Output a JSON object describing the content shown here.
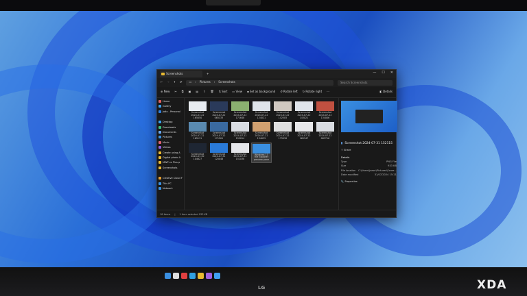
{
  "window": {
    "tab_title": "Screenshots",
    "new_tab": "+",
    "controls": [
      "—",
      "☐",
      "✕"
    ]
  },
  "address": {
    "nav": [
      "←",
      "→",
      "↑",
      "⟳"
    ],
    "breadcrumb": [
      "Pictures",
      "Screenshots"
    ],
    "search_placeholder": "Search Screenshots"
  },
  "commands": {
    "new": "New",
    "sort": "Sort",
    "view": "View",
    "set_background": "Set as background",
    "rotate_left": "Rotate left",
    "rotate_right": "Rotate right",
    "more": "···",
    "details": "Details"
  },
  "sidebar": [
    {
      "label": "Home",
      "color": "#e06060"
    },
    {
      "label": "Gallery",
      "color": "#3aa0f0"
    },
    {
      "label": "João - Personal",
      "color": "#2d7fe0"
    },
    {
      "label": "Desktop",
      "color": "#3aa0f0"
    },
    {
      "label": "Downloads",
      "color": "#3ac080"
    },
    {
      "label": "Documents",
      "color": "#6aa8f0"
    },
    {
      "label": "Pictures",
      "color": "#3a90e0"
    },
    {
      "label": "Music",
      "color": "#e06070"
    },
    {
      "label": "Videos",
      "color": "#9060e0"
    },
    {
      "label": "Create using A",
      "color": "#e8b931"
    },
    {
      "label": "Digital photo A",
      "color": "#e8b931"
    },
    {
      "label": "MWP vs Plus p",
      "color": "#e8b931"
    },
    {
      "label": "Screenshots",
      "color": "#e8b931"
    },
    {
      "label": "Creative Cloud F",
      "color": "#e8a030"
    },
    {
      "label": "This PC",
      "color": "#3a90e0"
    },
    {
      "label": "Network",
      "color": "#3a90e0"
    }
  ],
  "files": [
    {
      "name": "Screenshot 2024-07-22 165050"
    },
    {
      "name": "Screenshot 2024-07-22 065133"
    },
    {
      "name": "Screenshot 2024-07-22 171648"
    },
    {
      "name": "Screenshot 2024-07-22 124021"
    },
    {
      "name": "Screenshot 2024-07-22 142505"
    },
    {
      "name": "Screenshot 2024-07-22 143021"
    },
    {
      "name": "Screenshot 2024-07-22 134006"
    },
    {
      "name": "Screenshot 2024-07-22 165111"
    },
    {
      "name": "Screenshot 2024-07-22 171501"
    },
    {
      "name": "Screenshot 2024-07-22 155014"
    },
    {
      "name": "Screenshot 2024-07-22 134035"
    },
    {
      "name": "Screenshot 2024-07-22 175930"
    },
    {
      "name": "Screenshot 2024-07-22 165347"
    },
    {
      "name": "Screenshot 2024-07-22 083716"
    },
    {
      "name": "Screenshot 2024-07-30 104627"
    },
    {
      "name": "Screenshot 2024-07-31 120048"
    },
    {
      "name": "Screenshot 2024-07-31 152038"
    },
    {
      "name": "Windows 11 File Explorer preview pane"
    }
  ],
  "details": {
    "file_name": "Screenshot 2024-07-31 152115",
    "share": "Share",
    "heading": "Details",
    "props": [
      {
        "k": "Type",
        "v": "PNG File"
      },
      {
        "k": "Size",
        "v": "933 KB"
      },
      {
        "k": "File location",
        "v": "C:\\Users\\joaoc\\Pictures\\Scree..."
      },
      {
        "k": "Date modified",
        "v": "31/07/2024 15:21"
      }
    ],
    "properties": "Properties"
  },
  "status": {
    "count": "18 items",
    "selected": "1 item selected  933 KB"
  },
  "brand": {
    "monitor": "LG",
    "watermark": "XDA"
  }
}
